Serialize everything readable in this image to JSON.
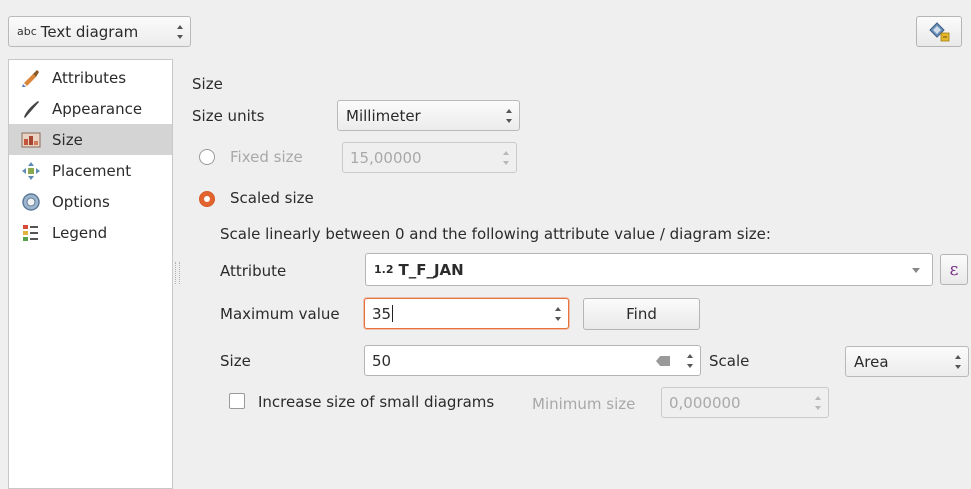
{
  "top": {
    "renderer_prefix": "abc",
    "renderer_label": "Text diagram",
    "style_button_icon": "diagram-settings-icon"
  },
  "sidebar": {
    "items": [
      {
        "label": "Attributes",
        "icon": "brush-icon"
      },
      {
        "label": "Appearance",
        "icon": "pen-icon"
      },
      {
        "label": "Size",
        "icon": "size-icon",
        "selected": true
      },
      {
        "label": "Placement",
        "icon": "placement-icon"
      },
      {
        "label": "Options",
        "icon": "options-gear-icon"
      },
      {
        "label": "Legend",
        "icon": "legend-icon"
      }
    ]
  },
  "size_section": {
    "title": "Size",
    "units_label": "Size units",
    "units_value": "Millimeter",
    "fixed_label": "Fixed size",
    "fixed_value": "15,00000",
    "scaled_label": "Scaled size",
    "scaled_description": "Scale linearly between 0 and the following attribute value / diagram size:",
    "attribute_label": "Attribute",
    "attribute_type_prefix": "1.2",
    "attribute_value": "T_F_JAN",
    "expression_button": "ε",
    "max_value_label": "Maximum value",
    "max_value": "35",
    "find_button": "Find",
    "size_label": "Size",
    "size_value": "50",
    "scale_label": "Scale",
    "scale_value": "Area",
    "increase_label": "Increase size of small diagrams",
    "min_size_label": "Minimum size",
    "min_size_value": "0,000000"
  },
  "colors": {
    "accent": "#e2642f",
    "selection": "#d4d4d4"
  }
}
